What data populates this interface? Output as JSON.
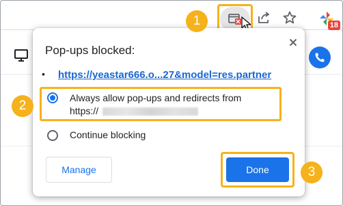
{
  "toolbar": {
    "popup_icon": "popup-blocked-icon",
    "share_icon": "share-icon",
    "star_icon": "bookmark-star-icon",
    "app_badge": "18"
  },
  "steps": [
    "1",
    "2",
    "3"
  ],
  "dialog": {
    "title": "Pop-ups blocked:",
    "bullet": "•",
    "link_text": "https://yeastar666.o...27&model=res.partner",
    "options": [
      {
        "label": "Always allow pop-ups and redirects from",
        "label_line2": "https://",
        "selected": true
      },
      {
        "label": "Continue blocking",
        "selected": false
      }
    ],
    "manage_label": "Manage",
    "done_label": "Done"
  },
  "colors": {
    "accent": "#1a73e8",
    "highlight": "#f6b21b",
    "badge": "#e8453c"
  }
}
